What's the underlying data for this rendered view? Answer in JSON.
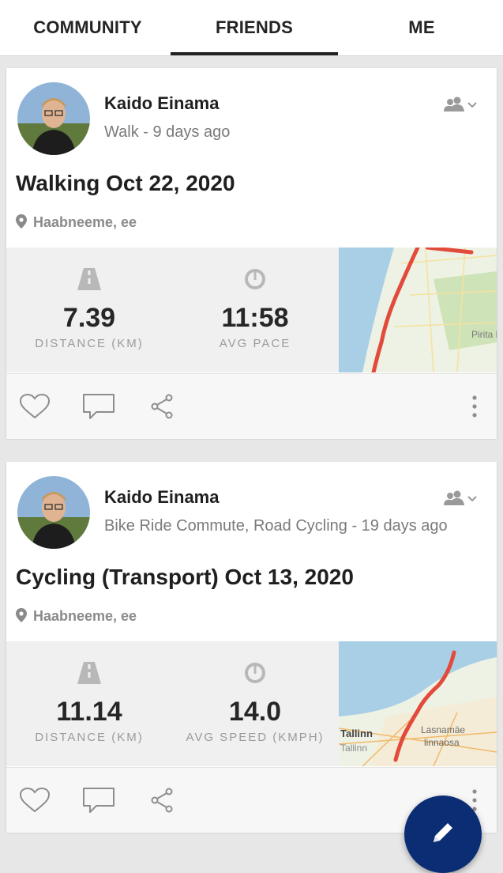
{
  "tabs": [
    {
      "label": "COMMUNITY"
    },
    {
      "label": "FRIENDS"
    },
    {
      "label": "ME"
    }
  ],
  "active_tab": "FRIENDS",
  "colors": {
    "accent": "#0b2d73",
    "route": "#e24b3b",
    "map_water": "#a9cfe6",
    "map_land": "#eef2e4"
  },
  "feed": [
    {
      "user": "Kaido Einama",
      "subtitle": "Walk - 9 days ago",
      "title": "Walking Oct 22, 2020",
      "location": "Haabneeme, ee",
      "stats": [
        {
          "icon": "road-icon",
          "value": "7.39",
          "label": "DISTANCE (KM)"
        },
        {
          "icon": "speedometer-icon",
          "value": "11:58",
          "label": "AVG PACE"
        }
      ],
      "map_labels": [
        "Pirita li"
      ]
    },
    {
      "user": "Kaido Einama",
      "subtitle": "Bike Ride Commute, Road Cycling - 19 days ago",
      "title": "Cycling (Transport) Oct 13, 2020",
      "location": "Haabneeme, ee",
      "stats": [
        {
          "icon": "road-icon",
          "value": "11.14",
          "label": "DISTANCE (KM)"
        },
        {
          "icon": "speedometer-icon",
          "value": "14.0",
          "label": "AVG SPEED (KMPH)"
        }
      ],
      "map_labels": [
        "Tallinn",
        "Lasnamäe",
        "linnaosa",
        "Tallinn"
      ]
    }
  ]
}
